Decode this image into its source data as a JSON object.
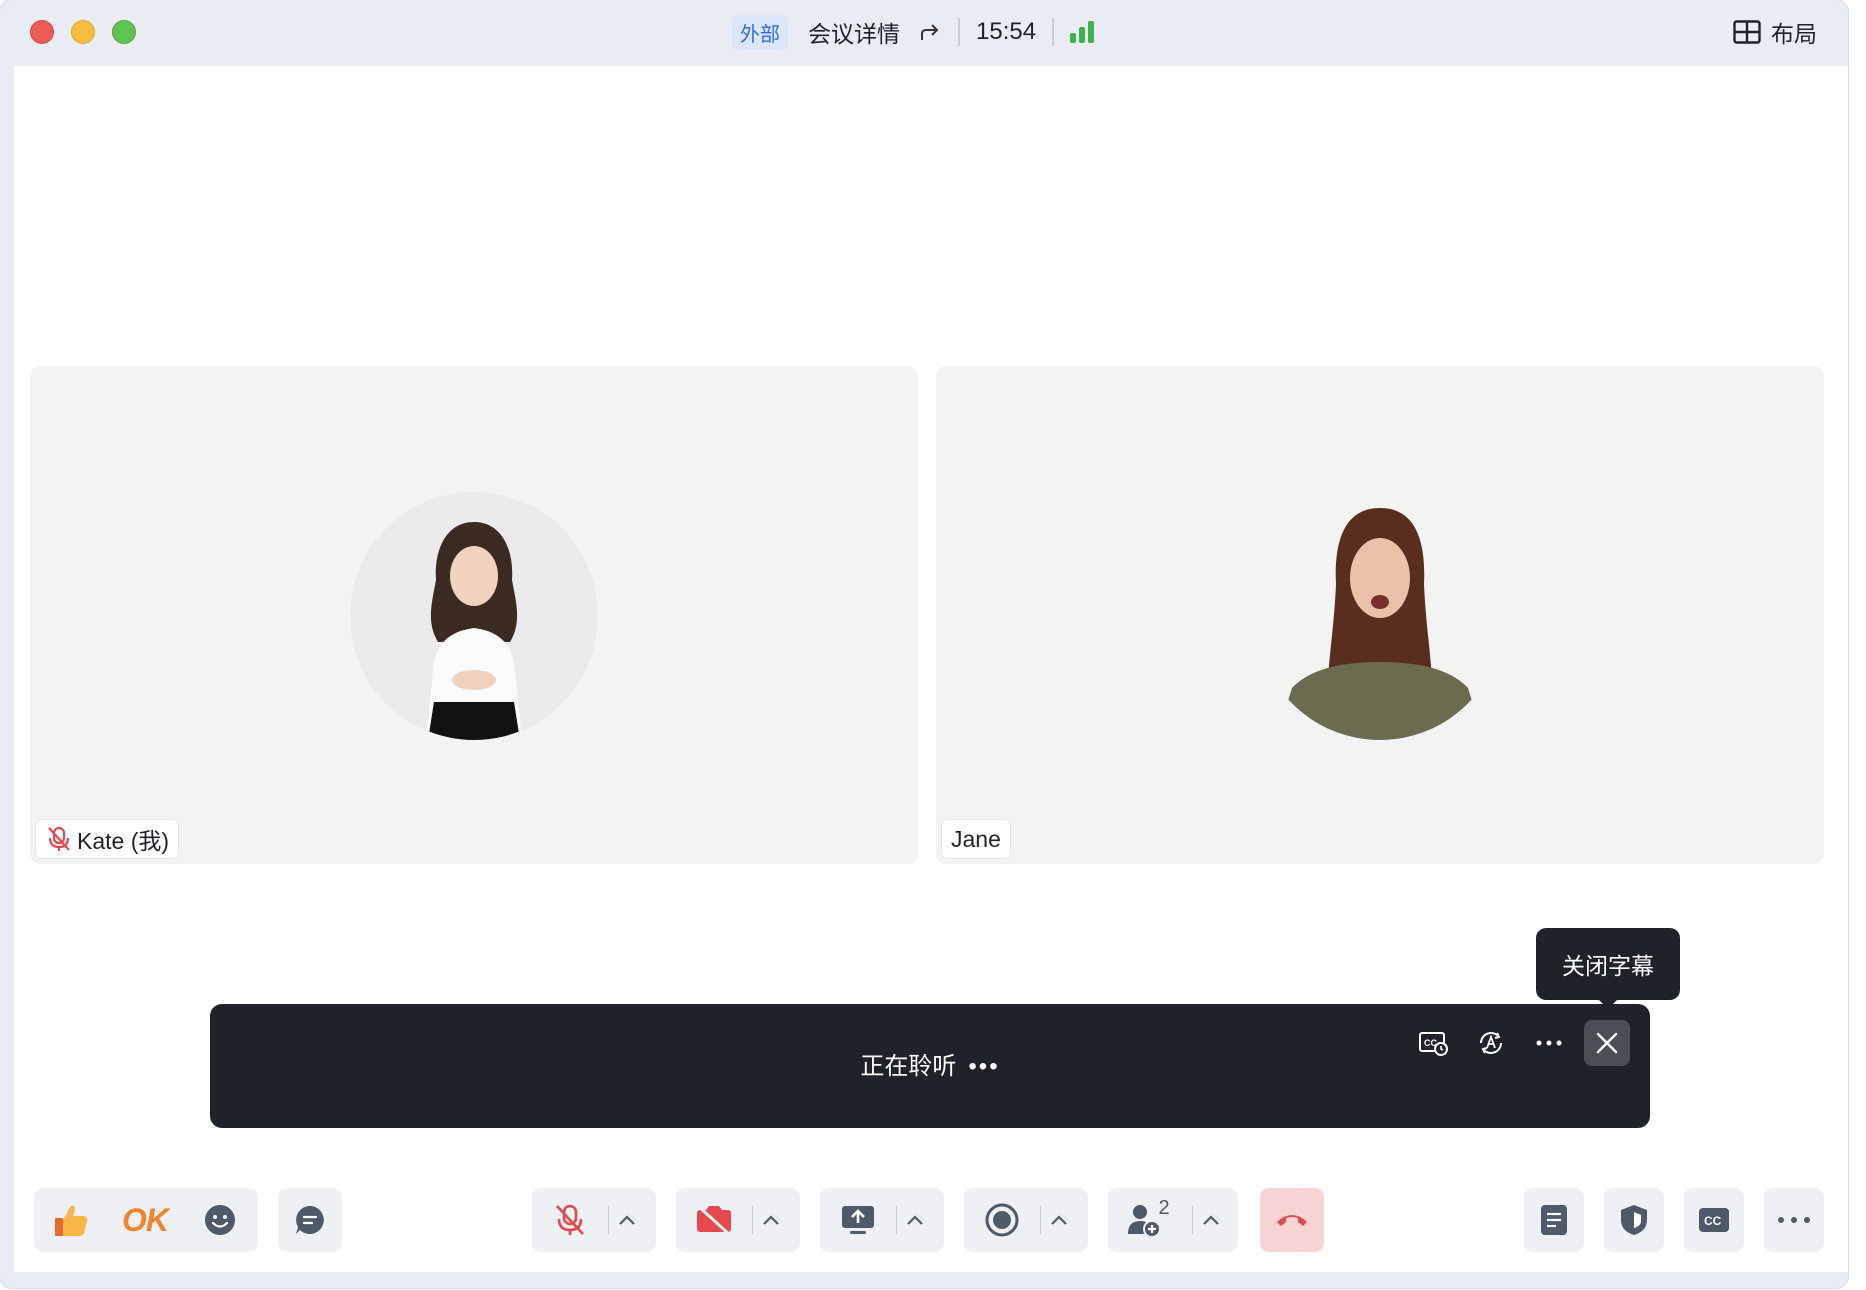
{
  "window": {
    "badge": "外部",
    "meeting_details": "会议详情",
    "clock": "15:54",
    "layout_label": "布局"
  },
  "participants": [
    {
      "name": "Kate (我)",
      "muted": true
    },
    {
      "name": "Jane",
      "muted": false
    }
  ],
  "captions": {
    "status_text": "正在聆听",
    "status_dots": "•••",
    "tooltip": "关闭字幕"
  },
  "toolbar": {
    "ok_label": "OK",
    "participants_count": "2"
  },
  "colors": {
    "accent_blue": "#2f6ce8",
    "signal_green": "#3fb250",
    "mute_red": "#e5484d",
    "hangup_bg": "#f8d3d3",
    "caption_bg": "#1f2329"
  }
}
